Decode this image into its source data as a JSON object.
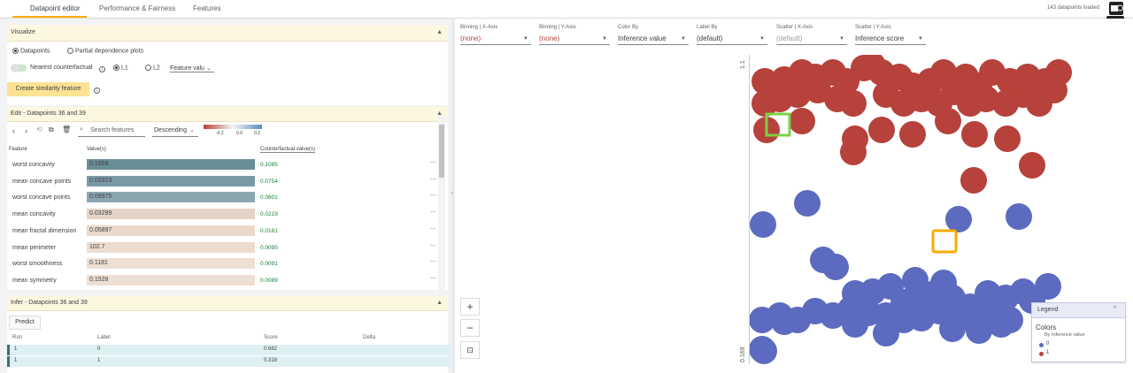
{
  "tabs": [
    {
      "label": "Datapoint editor"
    },
    {
      "label": "Performance & Fairness"
    },
    {
      "label": "Features"
    }
  ],
  "status": "143 datapoints loaded",
  "visualize": {
    "header": "Visualize",
    "datapoints": "Datapoints",
    "pdp": "Partial dependence plots",
    "nearest": "Nearest counterfactual",
    "l1": "L1",
    "l2": "L2",
    "feature_select": "Feature valu",
    "similarity": "Create similarity feature"
  },
  "edit": {
    "header": "Edit - Datapoints 36 and 39",
    "search_placeholder": "Search features",
    "sort": "Descending",
    "scale": [
      "-0.2",
      "0.0",
      "0.2"
    ],
    "col_feature": "Feature",
    "col_value": "Value(s)",
    "col_cf": "Counterfactual value(s)",
    "rows": [
      {
        "feature": "worst concavity",
        "value": "0.1659",
        "cf": "0.1085",
        "color": "#6a8e96"
      },
      {
        "feature": "mean concave points",
        "value": "0.03323",
        "cf": "0.0754",
        "color": "#7b9aa6"
      },
      {
        "feature": "worst concave points",
        "value": "0.09975",
        "cf": "0.0601",
        "color": "#8aa7b0"
      },
      {
        "feature": "mean concavity",
        "value": "0.03299",
        "cf": "0.0219",
        "color": "#e5d3c6"
      },
      {
        "feature": "mean fractal dimension",
        "value": "0.05897",
        "cf": "0.0161",
        "color": "#ead8cb"
      },
      {
        "feature": "mean perimeter",
        "value": "102.7",
        "cf": "0.0095",
        "color": "#ecdcd0"
      },
      {
        "feature": "worst smoothness",
        "value": "0.1181",
        "cf": "0.0091",
        "color": "#eddfd3"
      },
      {
        "feature": "mean symmetry",
        "value": "0.1528",
        "cf": "0.0089",
        "color": "#eedfd4"
      }
    ]
  },
  "infer": {
    "header": "Infer - Datapoints 36 and 39",
    "predict": "Predict",
    "cols": [
      "Run",
      "Label",
      "Score",
      "Delta"
    ],
    "rows": [
      {
        "run": "1",
        "label": "0",
        "score": "0.682",
        "delta": ""
      },
      {
        "run": "1",
        "label": "1",
        "score": "0.318",
        "delta": ""
      }
    ]
  },
  "controls": [
    {
      "label": "Binning | X-Axis",
      "value": "(none)"
    },
    {
      "label": "Binning | Y-Axis",
      "value": "(none)"
    },
    {
      "label": "Color By",
      "value": "Inference value"
    },
    {
      "label": "Label By",
      "value": "(default)"
    },
    {
      "label": "Scatter | X-Axis",
      "value": "(default)"
    },
    {
      "label": "Scatter | Y-Axis",
      "value": "Inference score"
    }
  ],
  "axis": {
    "top": "1.1",
    "bottom": "0.169"
  },
  "legend": {
    "title": "Legend",
    "colors": "Colors",
    "by": "By Inference value",
    "items": [
      {
        "label": "0",
        "color": "#5c6bc0"
      },
      {
        "label": "1",
        "color": "#b7413b"
      }
    ]
  },
  "colors": {
    "red": "#b7413b",
    "blue": "#5c6bc0",
    "accent": "#f9ab00"
  }
}
